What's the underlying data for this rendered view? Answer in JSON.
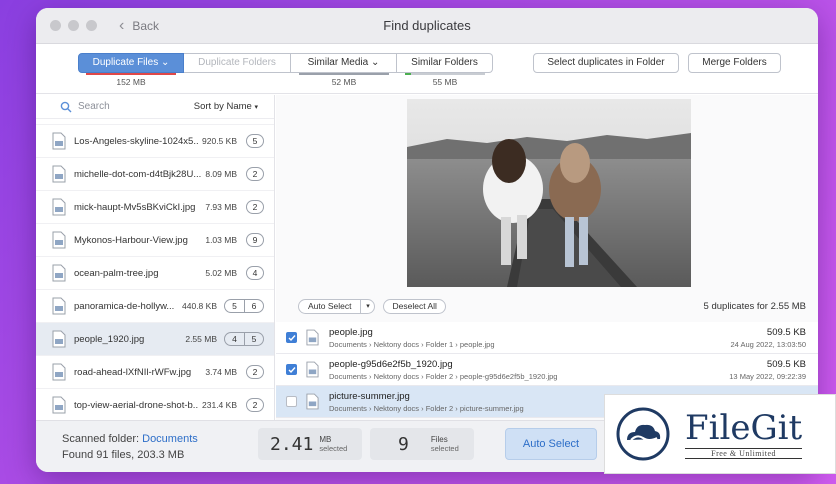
{
  "window": {
    "title": "Find duplicates",
    "back_label": "Back"
  },
  "tabs": [
    {
      "label": "Duplicate Files",
      "size": "152 MB"
    },
    {
      "label": "Duplicate Folders",
      "size": ""
    },
    {
      "label": "Similar Media",
      "size": "52 MB"
    },
    {
      "label": "Similar Folders",
      "size": "55 MB"
    }
  ],
  "toolbar": {
    "select_in_folder": "Select duplicates in Folder",
    "merge_folders": "Merge Folders"
  },
  "sidebar": {
    "search_placeholder": "Search",
    "sort_label": "Sort by Name",
    "files": [
      {
        "name": "Los-Angeles-skyline-1024x5...",
        "size": "920.5 KB",
        "count": "5"
      },
      {
        "name": "michelle-dot-com-d4tBjk28U...",
        "size": "8.09 MB",
        "count": "2"
      },
      {
        "name": "mick-haupt-Mv5sBKviCkI.jpg",
        "size": "7.93 MB",
        "count": "2"
      },
      {
        "name": "Mykonos-Harbour-View.jpg",
        "size": "1.03 MB",
        "count": "9"
      },
      {
        "name": "ocean-palm-tree.jpg",
        "size": "5.02 MB",
        "count": "4"
      },
      {
        "name": "panoramica-de-hollyw...",
        "size": "440.8 KB",
        "count": "5",
        "count2": "6"
      },
      {
        "name": "people_1920.jpg",
        "size": "2.55 MB",
        "count": "4",
        "count2": "5"
      },
      {
        "name": "road-ahead-lXfNIl-rWFw.jpg",
        "size": "3.74 MB",
        "count": "2"
      },
      {
        "name": "top-view-aerial-drone-shot-b...",
        "size": "231.4 KB",
        "count": "2"
      }
    ]
  },
  "main": {
    "auto_select": "Auto Select",
    "deselect_all": "Deselect All",
    "dup_count": "5 duplicates for 2.55 MB",
    "duplicates": [
      {
        "name": "people.jpg",
        "path": "Documents  ›  Nektony docs  ›  Folder 1  ›  people.jpg",
        "size": "509.5 KB",
        "date": "24 Aug 2022, 13:03:50"
      },
      {
        "name": "people-g95d6e2f5b_1920.jpg",
        "path": "Documents  ›  Nektony docs  ›  Folder 2  ›  people-g95d6e2f5b_1920.jpg",
        "size": "509.5 KB",
        "date": "13 May 2022, 09:22:39"
      },
      {
        "name": "picture-summer.jpg",
        "path": "Documents  ›  Nektony docs  ›  Folder 2  ›  picture-summer.jpg",
        "size": "",
        "date": ""
      }
    ]
  },
  "footer": {
    "scanned_label": "Scanned folder:",
    "scanned_folder": "Documents",
    "found": "Found 91 files, 203.3 MB",
    "selected_size": "2.41",
    "selected_unit": "MB",
    "selected_unit_sub": "selected",
    "files_count": "9",
    "files_label": "Files",
    "files_sub": "selected",
    "auto_select": "Auto Select"
  },
  "watermark": {
    "name": "FileGit",
    "tagline": "Free & Unlimited"
  },
  "colors": {
    "accent": "#5b8fd8",
    "link": "#2d6ec8",
    "bar_red": "#e04848",
    "bar_green": "#4caf50",
    "bar_grey": "#9aa0aa"
  }
}
